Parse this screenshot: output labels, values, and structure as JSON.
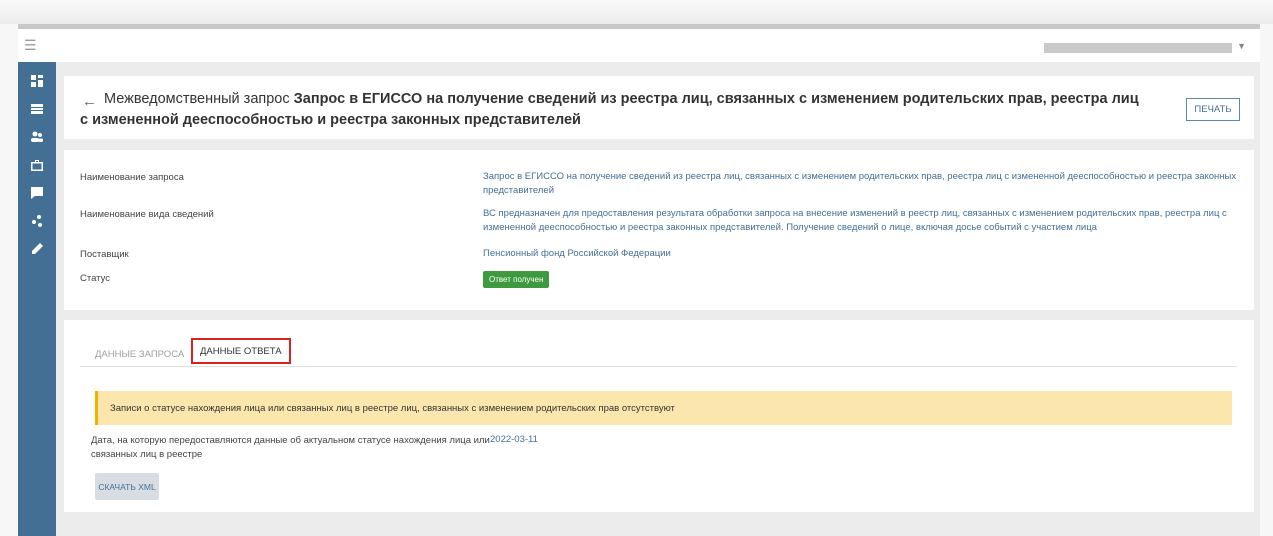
{
  "header": {
    "title_prefix": "Межведомственный запрос",
    "title_bold": "Запрос в ЕГИССО на получение сведений из реестра лиц, связанных с изменением родительских прав, реестра лиц с измененной дееспособностью и реестра законных представителей",
    "print_label": "ПЕЧАТЬ"
  },
  "info": {
    "request_name_label": "Наименование запроса",
    "request_name_value": "Запрос в ЕГИССО на получение сведений из реестра лиц, связанных с изменением родительских прав, реестра лиц с измененной дееспособностью и реестра законных представителей",
    "info_type_label": "Наименование вида сведений",
    "info_type_value": "ВС предназначен для предоставления результата обработки запроса на внесение изменений в реестр лиц, связанных с изменением родительских прав, реестра лиц с измененной дееспособностью и реестра законных представителей. Получение сведений о лице, включая досье событий с участием лица",
    "provider_label": "Поставщик",
    "provider_value": "Пенсионный фонд Российской Федерации",
    "status_label": "Статус",
    "status_value": "Ответ получен",
    "status_color": "#3e9a3e"
  },
  "tabs": {
    "request": "ДАННЫЕ ЗАПРОСА",
    "response": "ДАННЫЕ ОТВЕТА"
  },
  "response": {
    "alert_text": "Записи о статусе нахождения лица или связанных лиц в реестре лиц, связанных с изменением родительских прав отсутствуют",
    "date_label": "Дата, на которую передоставляются данные об актуальном статусе нахождения лица или связанных лиц в реестре",
    "date_value": "2022-03-11",
    "download_label": "СКАЧАТЬ XML"
  },
  "icons": {
    "menu": "menu-icon",
    "back": "arrow-left-icon",
    "sidebar": [
      "dashboard-icon",
      "list-icon",
      "users-icon",
      "briefcase-icon",
      "chat-icon",
      "network-icon",
      "pencil-icon"
    ]
  },
  "colors": {
    "sidebar": "#446f95",
    "link": "#446f95",
    "alert": "#fbe7ae",
    "highlight": "#d9231f"
  }
}
